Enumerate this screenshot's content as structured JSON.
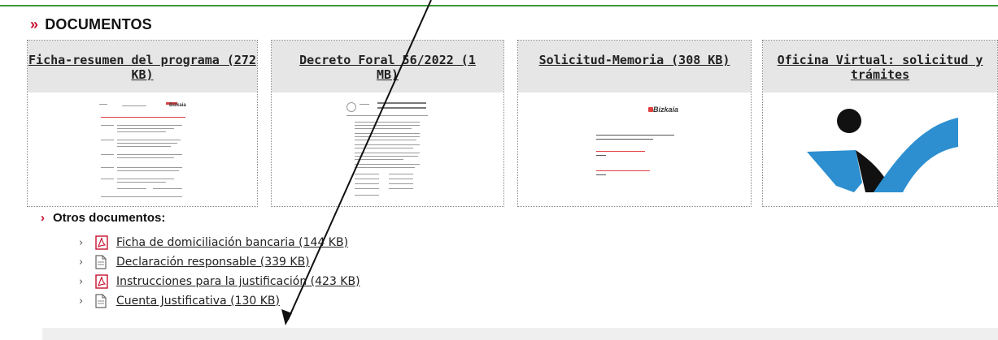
{
  "header": {
    "chevron": "»",
    "title": "DOCUMENTOS"
  },
  "cards": [
    {
      "label": "Ficha-resumen del programa (272 KB)",
      "thumb": "document-preview"
    },
    {
      "label": "Decreto Foral 56/2022 (1 MB)",
      "thumb": "decree-preview"
    },
    {
      "label": "Solicitud-Memoria (308 KB)",
      "thumb": "bizkaia-form-preview"
    },
    {
      "label": "Oficina Virtual: solicitud y trámites",
      "thumb": "oficina-virtual-logo"
    }
  ],
  "thumb_texts": {
    "bizkaia": "Bizkaia"
  },
  "other_docs": {
    "chevron": "›",
    "title": "Otros documentos:",
    "items": [
      {
        "label": "Ficha de domiciliación bancaria (144 KB)",
        "icon": "pdf-icon"
      },
      {
        "label": "Declaración responsable (339 KB)",
        "icon": "document-icon"
      },
      {
        "label": "Instrucciones para la justificación (423 KB)",
        "icon": "pdf-icon"
      },
      {
        "label": "Cuenta Justificativa (130 KB)",
        "icon": "document-icon"
      }
    ],
    "bullet": "›"
  },
  "colors": {
    "accent_red": "#c8102e",
    "top_border_green": "#3a9a3a",
    "card_header_bg": "#e6e6e6",
    "logo_blue": "#1f5f8f",
    "logo_black": "#111111"
  }
}
